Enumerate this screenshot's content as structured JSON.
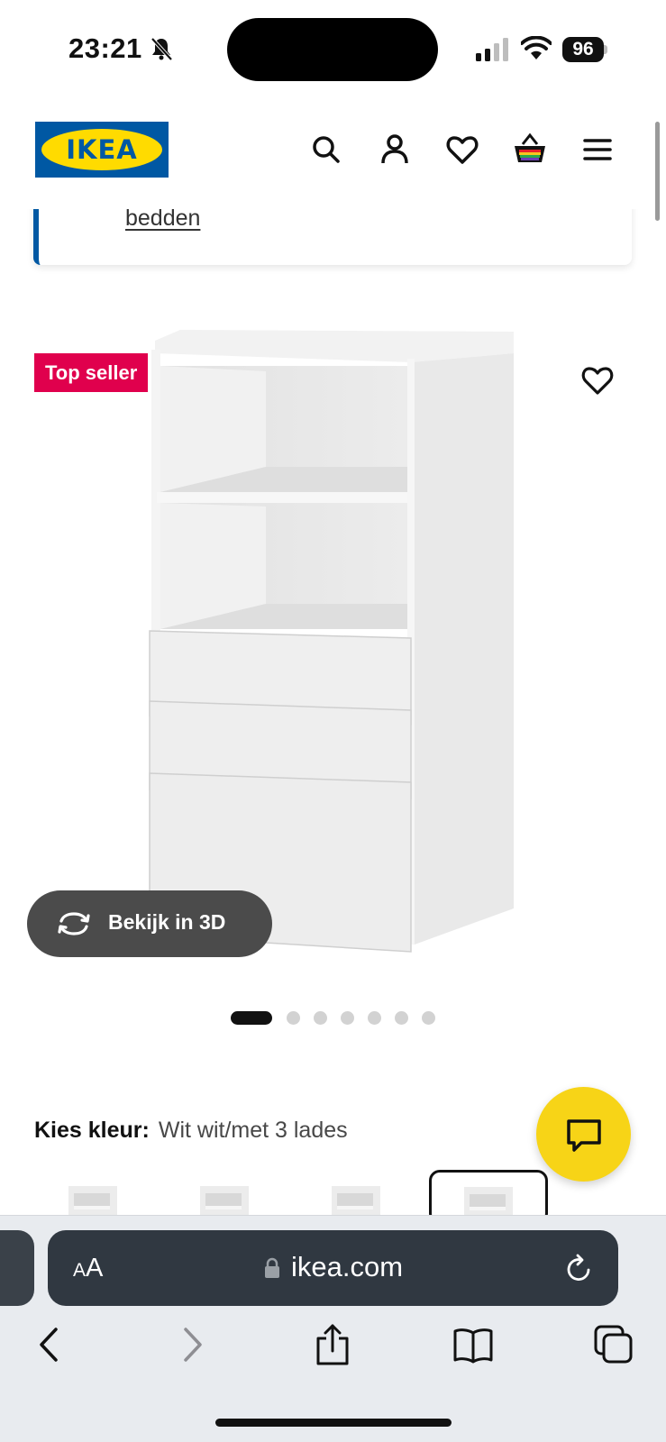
{
  "status_bar": {
    "time": "23:21",
    "battery": "96"
  },
  "header": {
    "logo_text": "IKEA",
    "icons": [
      "search-icon",
      "account-icon",
      "wishlist-icon",
      "cart-icon",
      "menu-icon"
    ]
  },
  "info_card": {
    "link_text": "bedden"
  },
  "product": {
    "badge": "Top seller",
    "view_3d_label": "Bekijk in 3D",
    "carousel_count": 7,
    "carousel_active": 1
  },
  "color_selection": {
    "label": "Kies kleur:",
    "value": "Wit wit/met 3 lades",
    "options_count": 4,
    "selected_index": 3
  },
  "browser": {
    "aa_label_small": "A",
    "aa_label_large": "A",
    "url": "ikea.com"
  },
  "colors": {
    "brand_blue": "#0058a3",
    "brand_yellow": "#ffdb00",
    "badge_red": "#e0004d",
    "chat_yellow": "#f7d417"
  }
}
